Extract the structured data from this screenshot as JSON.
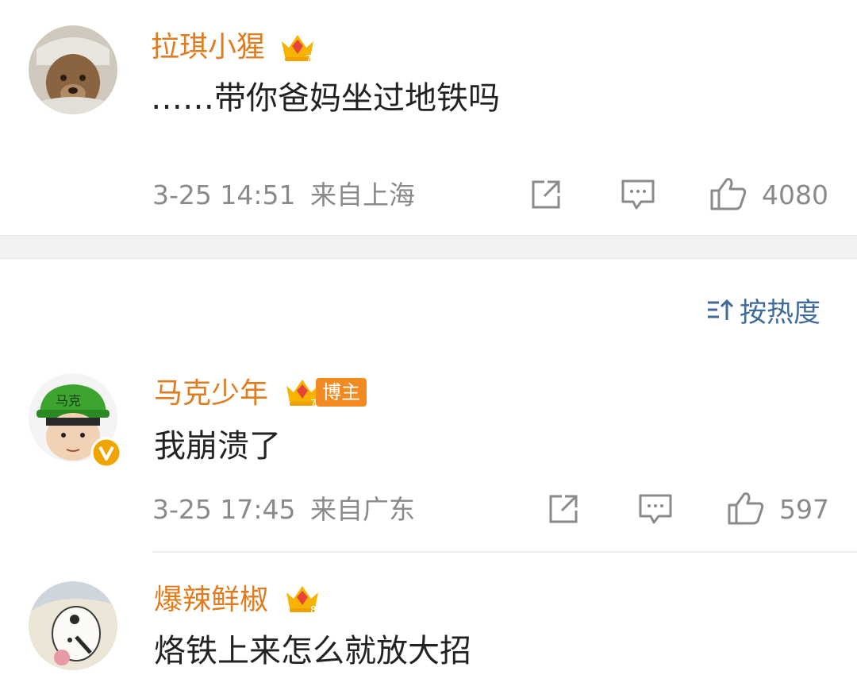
{
  "comments": [
    {
      "username": "拉琪小猩",
      "text": "……带你爸妈坐过地铁吗",
      "timestamp": "3-25 14:51",
      "location": "来自上海",
      "likes": "4080",
      "badge_level": "7",
      "avatar": "teddy-bear-avatar"
    },
    {
      "username": "马克少年",
      "text": "我崩溃了",
      "timestamp": "3-25 17:45",
      "location": "来自广东",
      "likes": "597",
      "badge_level": "7",
      "author_tag": "博主",
      "avatar_hat_text": "马克",
      "verified": true
    },
    {
      "username": "爆辣鲜椒",
      "text": "烙铁上来怎么就放大招",
      "badge_level": "8",
      "avatar": "cartoon-avatar"
    }
  ],
  "sort": {
    "label": "按热度",
    "icon": "sort-icon"
  },
  "colors": {
    "username": "#e07b1e",
    "text": "#222222",
    "meta": "#8a8a8a",
    "sort_link": "#3f6b9a",
    "band": "#f1f1f1"
  }
}
